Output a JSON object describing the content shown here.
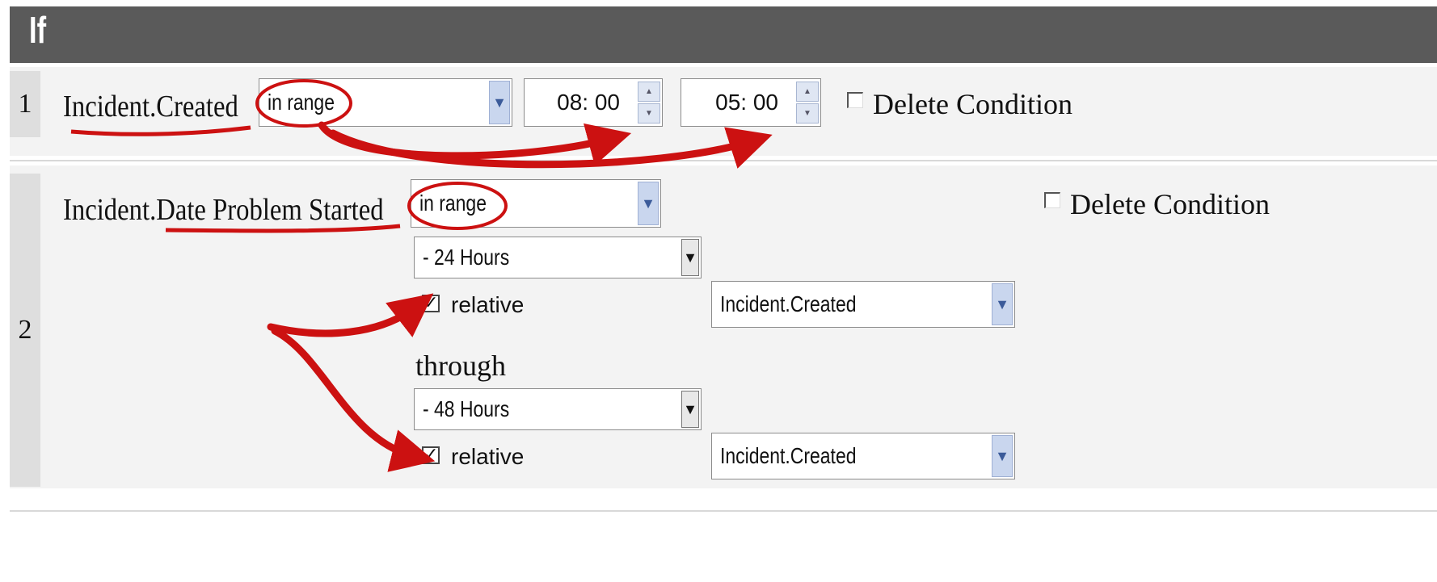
{
  "header": {
    "title": "If"
  },
  "conditions": [
    {
      "number": "1",
      "field": "Incident.Created",
      "operator": "in range",
      "start_time": "08: 00",
      "end_time": "05: 00",
      "delete_label": "Delete Condition"
    },
    {
      "number": "2",
      "field": "Incident.Date Problem Started",
      "operator": "in range",
      "delete_label": "Delete Condition",
      "from": {
        "offset": "-  24  Hours",
        "relative_label": "relative",
        "relative_checked": true,
        "relative_to": "Incident.Created"
      },
      "through_label": "through",
      "to": {
        "offset": "-  48  Hours",
        "relative_label": "relative",
        "relative_checked": true,
        "relative_to": "Incident.Created"
      }
    }
  ],
  "colors": {
    "header_bg": "#5a5a5a",
    "row_bg": "#f3f3f3",
    "annotation": "#cc1111"
  },
  "icons": {
    "dropdown": "chevron-down-icon",
    "spinner": "spinner-icon",
    "check": "check-icon"
  }
}
